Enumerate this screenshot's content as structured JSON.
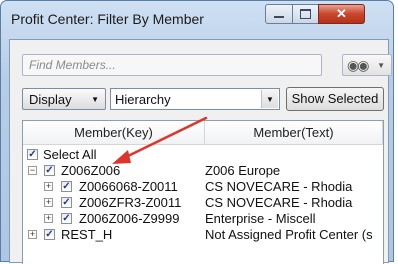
{
  "window": {
    "title": "Profit Center: Filter By Member",
    "min_label": "",
    "close_label": "✕"
  },
  "search": {
    "placeholder": "Find Members...",
    "find_icon": "binoculars-icon"
  },
  "toolbar": {
    "display_label": "Display",
    "hierarchy_value": "Hierarchy",
    "show_selected_label": "Show Selected"
  },
  "tree": {
    "columns": [
      "Member(Key)",
      "Member(Text)"
    ],
    "select_all_label": "Select All",
    "rows": [
      {
        "key": "Z006Z006",
        "text": "Z006 Europe"
      },
      {
        "key": "Z0066068-Z0011",
        "text": "CS NOVECARE - Rhodia"
      },
      {
        "key": "Z006ZFR3-Z0011",
        "text": "CS NOVECARE - Rhodia"
      },
      {
        "key": "Z006Z006-Z9999",
        "text": "Enterprise - Miscell"
      },
      {
        "key": "REST_H",
        "text": "Not Assigned Profit Center (s"
      }
    ]
  },
  "colors": {
    "annotation_arrow": "#e0342a",
    "close_button": "#c9452c"
  }
}
